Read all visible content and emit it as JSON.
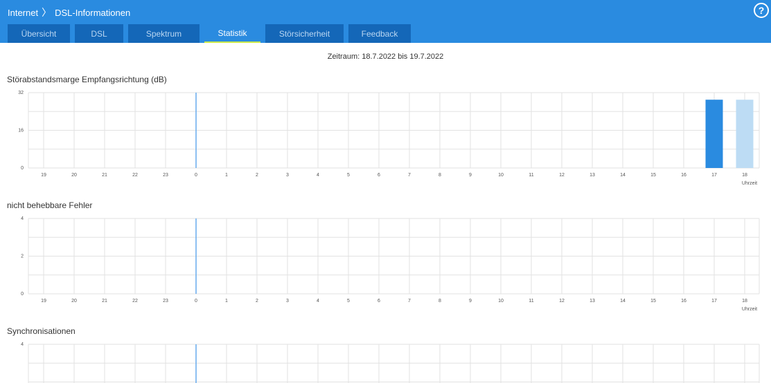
{
  "breadcrumb": {
    "parent": "Internet",
    "separator": "〉",
    "current": "DSL-Informationen"
  },
  "help": {
    "icon": "help-icon",
    "label": "?"
  },
  "tabs": [
    {
      "label": "Übersicht",
      "active": false
    },
    {
      "label": "DSL",
      "active": false
    },
    {
      "label": "Spektrum",
      "active": false
    },
    {
      "label": "Statistik",
      "active": true
    },
    {
      "label": "Störsicherheit",
      "active": false
    },
    {
      "label": "Feedback",
      "active": false
    }
  ],
  "period": "Zeitraum: 18.7.2022 bis 19.7.2022",
  "colors": {
    "header": "#2a8be0",
    "tab": "#1467b8",
    "tab_active_underline": "#c9e84a",
    "bar_primary": "#2a8be0",
    "bar_secondary": "#bddcf4",
    "now_marker": "#66aaee"
  },
  "chart_data": [
    {
      "type": "bar",
      "title": "Störabstandsmarge Empfangsrichtung (dB)",
      "xlabel": "Uhrzeit",
      "categories": [
        "19",
        "20",
        "21",
        "22",
        "23",
        "0",
        "1",
        "2",
        "3",
        "4",
        "5",
        "6",
        "7",
        "8",
        "9",
        "10",
        "11",
        "12",
        "13",
        "14",
        "15",
        "16",
        "17",
        "18"
      ],
      "yticks": [
        "0",
        "16",
        "32"
      ],
      "ylim": [
        0,
        32
      ],
      "grid": true,
      "now_marker_at": "0",
      "series": [
        {
          "values": [
            0,
            0,
            0,
            0,
            0,
            0,
            0,
            0,
            0,
            0,
            0,
            0,
            0,
            0,
            0,
            0,
            0,
            0,
            0,
            0,
            0,
            0,
            29,
            0
          ]
        },
        {
          "values": [
            0,
            0,
            0,
            0,
            0,
            0,
            0,
            0,
            0,
            0,
            0,
            0,
            0,
            0,
            0,
            0,
            0,
            0,
            0,
            0,
            0,
            0,
            0,
            29
          ]
        }
      ]
    },
    {
      "type": "bar",
      "title": "nicht behebbare Fehler",
      "xlabel": "Uhrzeit",
      "categories": [
        "19",
        "20",
        "21",
        "22",
        "23",
        "0",
        "1",
        "2",
        "3",
        "4",
        "5",
        "6",
        "7",
        "8",
        "9",
        "10",
        "11",
        "12",
        "13",
        "14",
        "15",
        "16",
        "17",
        "18"
      ],
      "yticks": [
        "0",
        "2",
        "4"
      ],
      "ylim": [
        0,
        4
      ],
      "grid": true,
      "now_marker_at": "0",
      "series": []
    },
    {
      "type": "bar",
      "title": "Synchronisationen",
      "xlabel": "",
      "categories": [],
      "yticks": [
        "4"
      ],
      "ylim": [
        0,
        4
      ],
      "grid": true,
      "now_marker_at": "0",
      "series": []
    }
  ]
}
